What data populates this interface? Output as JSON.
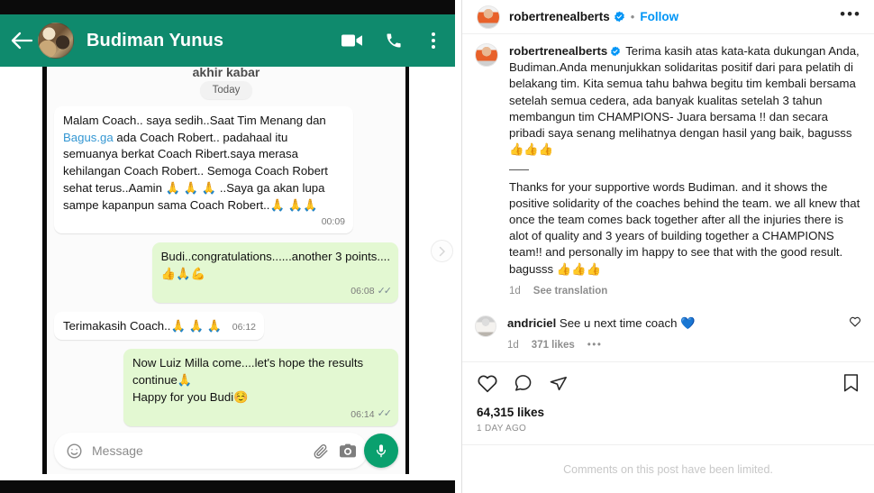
{
  "whatsapp": {
    "header": {
      "back_icon": "arrow-left-icon",
      "avatar": "contact-avatar",
      "contact_name": "Budiman Yunus",
      "video_call_icon": "video-camera-icon",
      "voice_call_icon": "phone-icon",
      "menu_icon": "kebab-menu-icon"
    },
    "cut_off_text": "akhir kabar",
    "day_divider": "Today",
    "messages": [
      {
        "direction": "incoming",
        "text_before_link": "Malam Coach.. saya sedih..Saat Tim Menang dan ",
        "link_text": "Bagus.ga",
        "text_after_link": " ada Coach Robert.. padahaal itu semuanya berkat Coach Ribert.saya merasa kehilangan Coach Robert.. Semoga Coach Robert sehat terus..Aamin 🙏 🙏 🙏 ..Saya ga akan lupa sampe kapanpun sama Coach Robert..🙏 🙏🙏",
        "time": "00:09",
        "ticks": ""
      },
      {
        "direction": "outgoing",
        "text": "Budi..congratulations......another 3 points....\n👍🙏💪",
        "time": "06:08",
        "ticks": "✓✓"
      },
      {
        "direction": "incoming",
        "text": "Terimakasih Coach..🙏 🙏 🙏",
        "time": "06:12",
        "ticks": ""
      },
      {
        "direction": "outgoing",
        "text": "Now Luiz Milla come....let's hope the results continue🙏\nHappy for you Budi☺️",
        "time": "06:14",
        "ticks": "✓✓"
      }
    ],
    "input_bar": {
      "emoji_icon": "emoji-smiley-icon",
      "placeholder": "Message",
      "attach_icon": "paperclip-icon",
      "camera_icon": "camera-icon",
      "mic_icon": "microphone-icon"
    },
    "next_arrow_icon": "chevron-right-icon"
  },
  "instagram": {
    "header": {
      "avatar": "profile-avatar",
      "username": "robertrenealberts",
      "verified_icon": "verified-badge-icon",
      "separator": "•",
      "follow_label": "Follow",
      "more_icon": "ellipsis-icon"
    },
    "caption": {
      "avatar": "caption-avatar",
      "username": "robertrenealberts",
      "verified_icon": "verified-badge-icon",
      "text_id": "Terima kasih atas kata-kata dukungan Anda, Budiman.Anda menunjukkan solidaritas positif dari para pelatih di belakang tim. Kita semua tahu bahwa begitu tim kembali bersama setelah semua cedera, ada banyak kualitas setelah 3 tahun membangun tim CHAMPIONS- Juara bersama !! dan secara pribadi saya senang melihatnya dengan hasil yang baik, bagusss👍👍👍",
      "text_en": "Thanks for your supportive words Budiman. and it shows the positive solidarity of the coaches behind the team. we all knew that once the team comes back together after all the injuries there is alot of quality and 3 years of building together a CHAMPIONS team!! and personally im happy to see that with the good result. bagusss 👍👍👍",
      "age": "1d",
      "translate_label": "See translation"
    },
    "reply": {
      "avatar": "commenter-avatar",
      "username": "andriciel",
      "text": "See u next time coach 💙",
      "age": "1d",
      "likes": "371 likes",
      "more_icon": "ellipsis-icon",
      "like_icon": "heart-outline-icon"
    },
    "actions": {
      "like_icon": "heart-outline-icon",
      "comment_icon": "comment-bubble-icon",
      "share_icon": "paper-plane-icon",
      "save_icon": "bookmark-icon",
      "likes_count": "64,315 likes",
      "posted_time": "1 DAY AGO"
    },
    "limited_notice": "Comments on this post have been limited."
  },
  "colors": {
    "whatsapp_header": "#0f8a6d",
    "outgoing_bubble": "#e3f8d2",
    "instagram_blue": "#0095f6",
    "mic_green": "#0aa06e"
  }
}
